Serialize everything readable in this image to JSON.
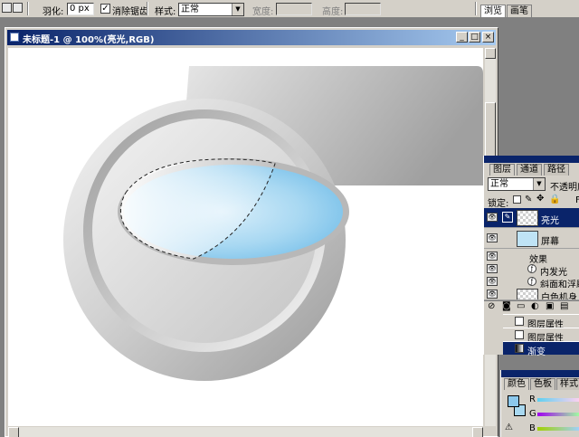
{
  "toolbar": {
    "feather_label": "羽化:",
    "feather_value": "0 px",
    "antialias_label": "消除锯齿",
    "antialias_check": "✓",
    "style_label": "样式:",
    "style_value": "正常",
    "width_label": "宽度:",
    "height_label": "高度:",
    "panel_tabs": [
      "浏览",
      "画笔"
    ]
  },
  "document": {
    "title": "未标题-1 @ 100%(亮光,RGB)",
    "minimize": "_",
    "maximize": "□",
    "close": "×"
  },
  "layers_panel": {
    "tabs": [
      "图层",
      "通道",
      "路径"
    ],
    "blend_mode": "正常",
    "opacity_label": "不透明度",
    "lock_label": "锁定:",
    "fill_label": "F",
    "layers": [
      {
        "name": "亮光",
        "selected": true
      },
      {
        "name": "屏幕",
        "selected": false
      },
      {
        "name": "白色机身",
        "selected": false
      }
    ],
    "effects_label": "效果",
    "effects": [
      "内发光",
      "斜面和浮雕"
    ],
    "fx_glyph": "ƒ"
  },
  "history": {
    "items": [
      {
        "name": "图层属性",
        "selected": false
      },
      {
        "name": "图层属性",
        "selected": false
      },
      {
        "name": "渐变",
        "selected": true
      }
    ]
  },
  "color_panel": {
    "tabs": [
      "颜色",
      "色板",
      "样式"
    ],
    "channels": [
      "R",
      "G",
      "B"
    ]
  },
  "colors": {
    "title_start": "#0a246a",
    "selection": "#0a246a",
    "chrome": "#d4d0c8",
    "screen_blue": "#a8d8f0"
  }
}
